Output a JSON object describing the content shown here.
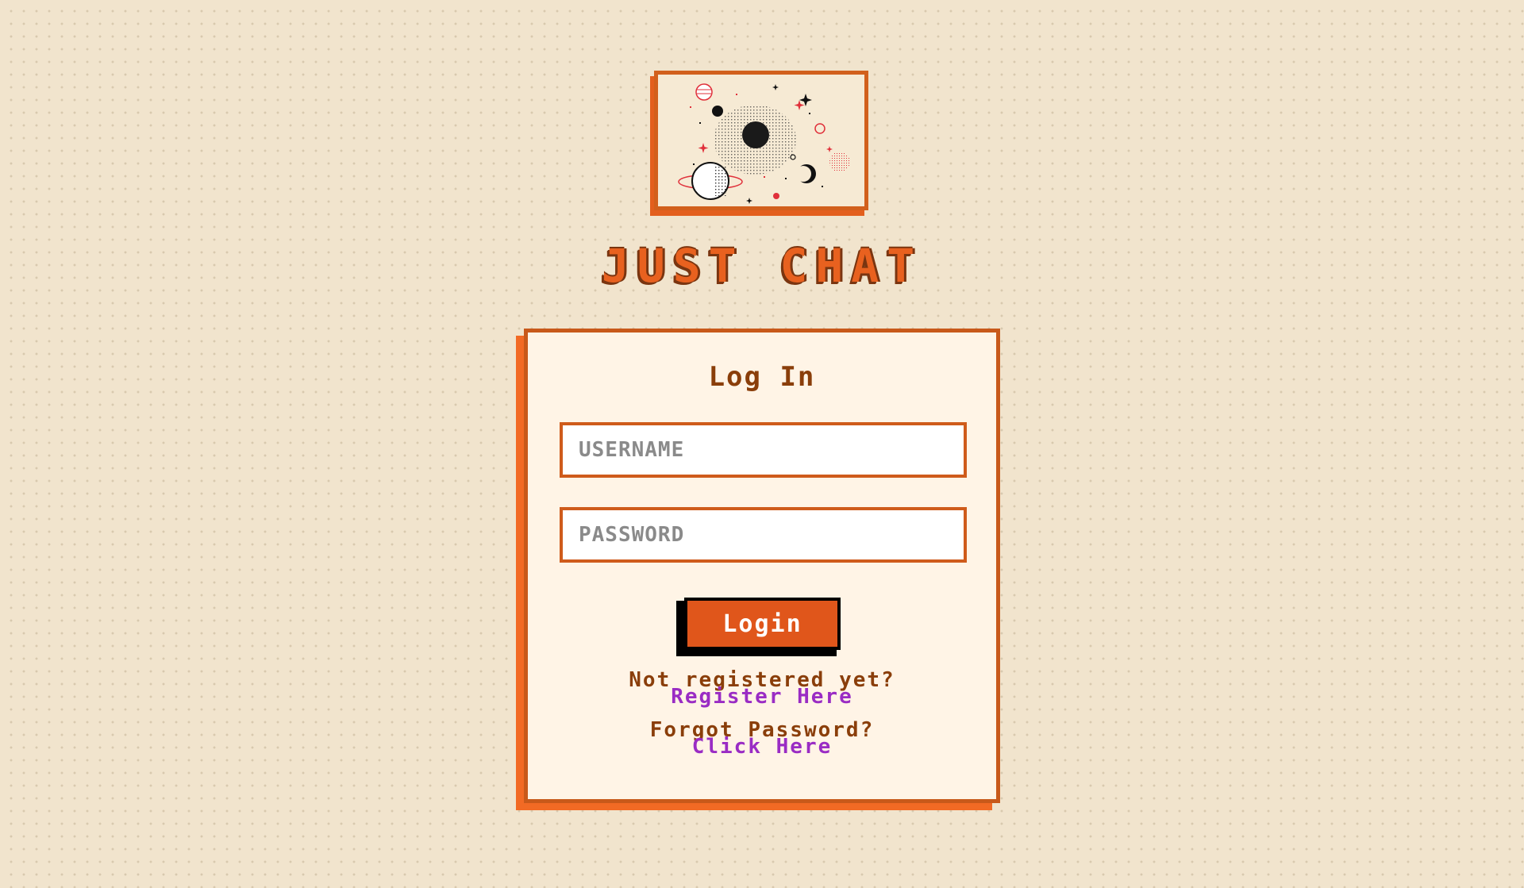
{
  "app": {
    "title": "JUST CHAT"
  },
  "logo": {
    "icon": "space-planets-illustration"
  },
  "login_card": {
    "title": "Log In",
    "username": {
      "placeholder": "USERNAME",
      "value": ""
    },
    "password": {
      "placeholder": "PASSWORD",
      "value": ""
    },
    "submit_label": "Login",
    "register_prompt": "Not registered yet?",
    "register_link": "Register Here",
    "forgot_prompt": "Forgot Password?",
    "forgot_link": "Click Here"
  },
  "colors": {
    "background": "#f1e4cd",
    "accent": "#e0561b",
    "card_background": "#fff4e6",
    "link": "#9a2cc4",
    "text": "#8a3e0a"
  }
}
